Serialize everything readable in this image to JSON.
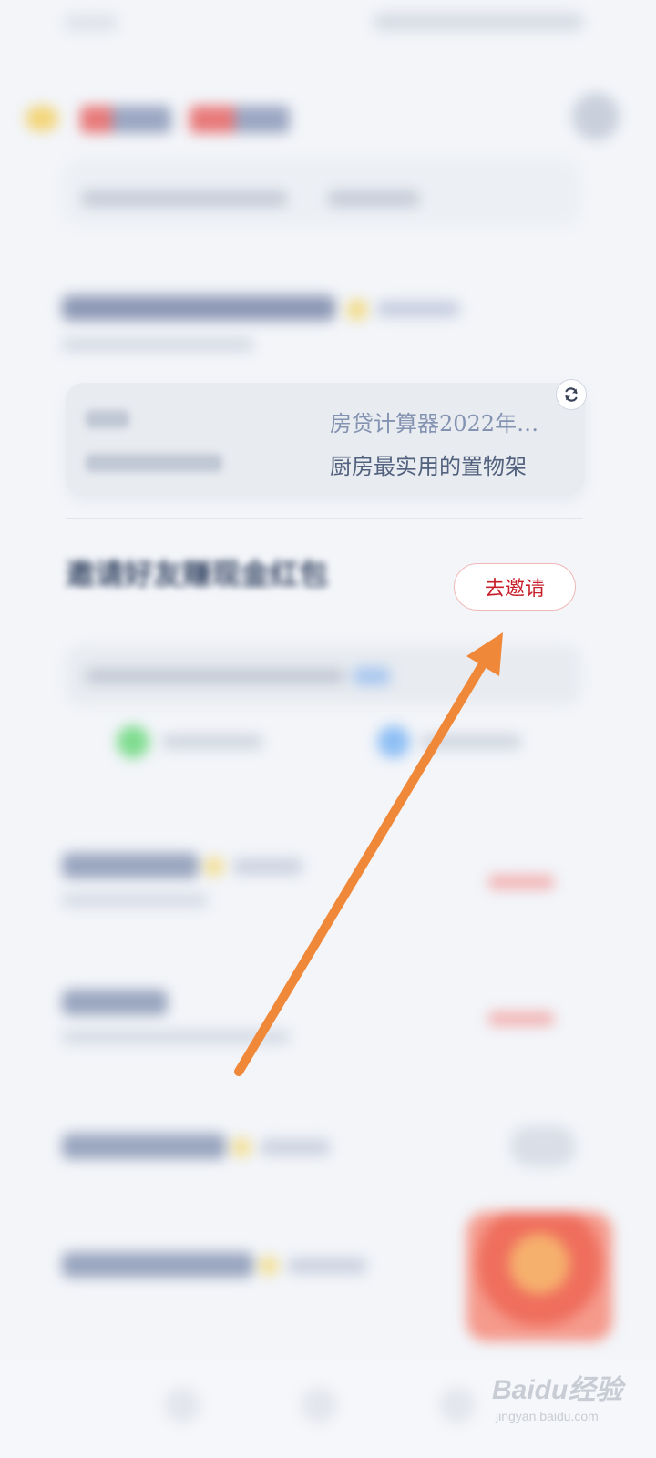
{
  "word_card": {
    "words": [
      "房贷计算器2022年…",
      "厨房最实用的置物架"
    ]
  },
  "invite": {
    "title": "邀请好友赚现金红包",
    "button_label": "去邀请"
  },
  "watermark": {
    "logo_text": "Baidu经验",
    "url": "jingyan.baidu.com"
  },
  "colors": {
    "accent_red": "#c71f2a",
    "arrow": "#f0883a",
    "background": "#f3f5f9"
  },
  "icons": [
    "refresh-icon",
    "arrow-annotation"
  ]
}
